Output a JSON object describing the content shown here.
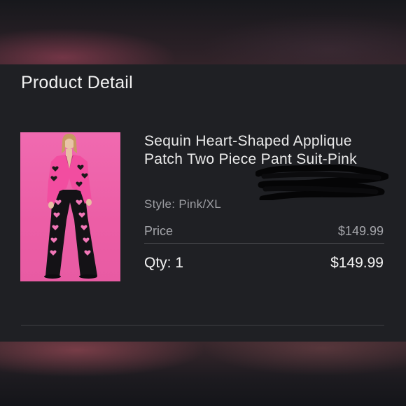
{
  "header": {
    "title": "Product Detail"
  },
  "product": {
    "image_icon": "product-photo",
    "name": "Sequin Heart-Shaped Applique Patch Two Piece Pant Suit-Pink",
    "style": "Style: Pink/XL",
    "price_label": "Price",
    "price": "$149.99",
    "qty": "Qty: 1",
    "total": "$149.99"
  },
  "colors": {
    "panel": "#1f2024",
    "image_background": "#ec5ea6",
    "text_primary": "#f4f4f4",
    "text_secondary": "#a4a5aa"
  }
}
